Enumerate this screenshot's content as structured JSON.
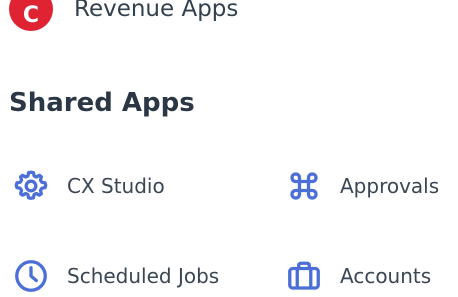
{
  "revenue": {
    "badge_letter": "C",
    "label": "Revenue Apps",
    "badge_color": "#df2332"
  },
  "shared": {
    "title": "Shared Apps",
    "accent_color": "#4b6fd6",
    "apps": [
      {
        "label": "CX Studio",
        "icon": "gear-icon"
      },
      {
        "label": "Approvals",
        "icon": "command-icon"
      },
      {
        "label": "Scheduled Jobs",
        "icon": "clock-icon"
      },
      {
        "label": "Accounts",
        "icon": "briefcase-icon"
      }
    ]
  }
}
